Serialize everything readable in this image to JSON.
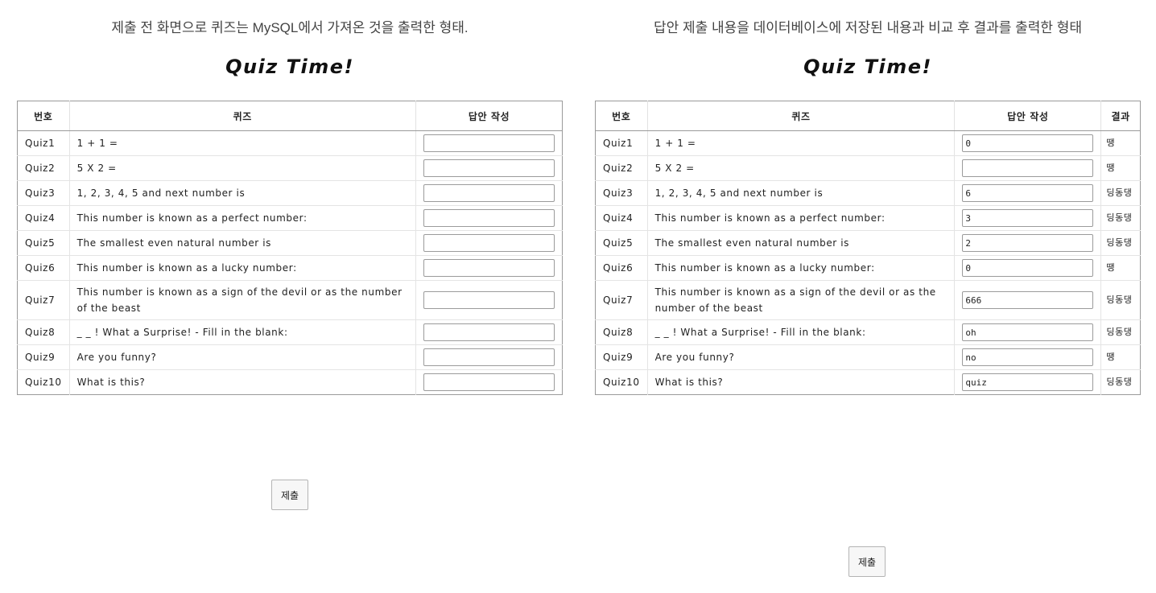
{
  "left": {
    "caption": "제출 전 화면으로 퀴즈는 MySQL에서 가져온 것을 출력한 형태.",
    "title": "Quiz Time!",
    "headers": {
      "num": "번호",
      "quiz": "퀴즈",
      "answer": "답안 작성"
    },
    "rows": [
      {
        "num": "Quiz1",
        "quiz": "1 + 1 =",
        "answer": ""
      },
      {
        "num": "Quiz2",
        "quiz": "5 X 2 =",
        "answer": ""
      },
      {
        "num": "Quiz3",
        "quiz": "1, 2, 3, 4, 5 and next number is",
        "answer": ""
      },
      {
        "num": "Quiz4",
        "quiz": "This number is known as a perfect number:",
        "answer": ""
      },
      {
        "num": "Quiz5",
        "quiz": "The smallest even natural number is",
        "answer": ""
      },
      {
        "num": "Quiz6",
        "quiz": "This number is known as a lucky number:",
        "answer": ""
      },
      {
        "num": "Quiz7",
        "quiz": "This number is known as a sign of the devil or as the number of the beast",
        "answer": ""
      },
      {
        "num": "Quiz8",
        "quiz": "_ _ ! What a Surprise! - Fill in the blank:",
        "answer": ""
      },
      {
        "num": "Quiz9",
        "quiz": "Are you funny?",
        "answer": ""
      },
      {
        "num": "Quiz10",
        "quiz": "What is this?",
        "answer": ""
      }
    ],
    "submit_label": "제출"
  },
  "right": {
    "caption": "답안 제출 내용을 데이터베이스에 저장된 내용과 비교 후 결과를 출력한 형태",
    "title": "Quiz Time!",
    "headers": {
      "num": "번호",
      "quiz": "퀴즈",
      "answer": "답안 작성",
      "result": "결과"
    },
    "rows": [
      {
        "num": "Quiz1",
        "quiz": "1 + 1 =",
        "answer": "0",
        "result": "땡"
      },
      {
        "num": "Quiz2",
        "quiz": "5 X 2 =",
        "answer": "",
        "result": "땡"
      },
      {
        "num": "Quiz3",
        "quiz": "1, 2, 3, 4, 5 and next number is",
        "answer": "6",
        "result": "딩동댕"
      },
      {
        "num": "Quiz4",
        "quiz": "This number is known as a perfect number:",
        "answer": "3",
        "result": "딩동댕"
      },
      {
        "num": "Quiz5",
        "quiz": "The smallest even natural number is",
        "answer": "2",
        "result": "딩동댕"
      },
      {
        "num": "Quiz6",
        "quiz": "This number is known as a lucky number:",
        "answer": "0",
        "result": "땡"
      },
      {
        "num": "Quiz7",
        "quiz": "This number is known as a sign of the devil or as the number of the beast",
        "answer": "666",
        "result": "딩동댕"
      },
      {
        "num": "Quiz8",
        "quiz": "_ _ ! What a Surprise! - Fill in the blank:",
        "answer": "oh",
        "result": "딩동댕"
      },
      {
        "num": "Quiz9",
        "quiz": "Are you funny?",
        "answer": "no",
        "result": "땡"
      },
      {
        "num": "Quiz10",
        "quiz": "What is this?",
        "answer": "quiz",
        "result": "딩동댕"
      }
    ],
    "submit_label": "제출"
  }
}
